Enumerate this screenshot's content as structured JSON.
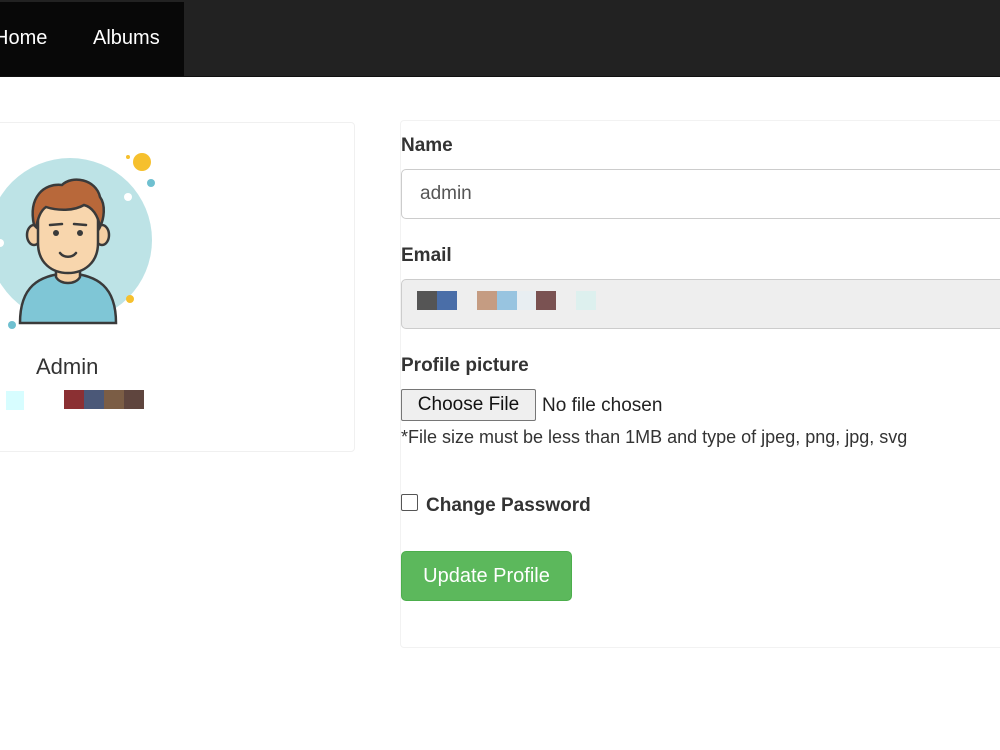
{
  "nav": {
    "home_label": "Home",
    "albums_label": "Albums",
    "background_color": "#222222"
  },
  "profile": {
    "name": "Admin",
    "avatar_icon": "user-avatar-icon"
  },
  "form": {
    "name_label": "Name",
    "name_value": "admin",
    "email_label": "Email",
    "profile_picture_label": "Profile picture",
    "choose_file_label": "Choose File",
    "no_file_text": "No file chosen",
    "file_hint": "*File size must be less than 1MB and type of jpeg, png, jpg, svg",
    "change_password_label": "Change Password",
    "change_password_checked": false,
    "update_button_label": "Update Profile",
    "update_button_color": "#5cb85c"
  }
}
